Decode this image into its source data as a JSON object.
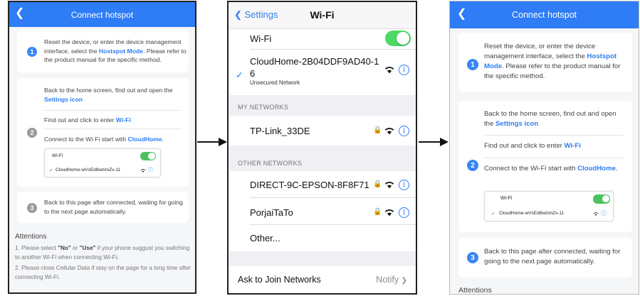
{
  "left_screen": {
    "title": "Connect hotspot",
    "step1": {
      "num": "1",
      "pre": "Reset the device, or enter the device management interface, select the ",
      "hl": "Hostspot Mode",
      "post": ". Please refer to the product manual for the specific method."
    },
    "step2": {
      "num": "2",
      "line1_pre": "Back to the home screen, find out and open the ",
      "line1_hl": "Settings icon",
      "line2_pre": "Find out and click to enter ",
      "line2_hl": "Wi-Fi",
      "line3_pre": "Connect to the Wi-Fi start with ",
      "line3_hl": "CloudHome",
      "line3_post": "."
    },
    "mini_wifi": {
      "label": "Wi-Fi",
      "network": "CloudHome-wVsEd8wzimZv-11"
    },
    "step3": {
      "num": "3",
      "text": "Back to this page after connected, waiting for going to the next page automatically."
    },
    "attentions": {
      "title": "Attentions",
      "item1_pre": "1. Please select ",
      "item1_no": "\"No\"",
      "item1_mid": " or ",
      "item1_use": "\"Use\"",
      "item1_post": " if your phone suggust you switching to another Wi-Fi when connecting Wi-Fi;",
      "item2": "2. Please close Cellular Data if stay on the page for a long time after connecting Wi-Fi."
    }
  },
  "middle_screen": {
    "back_label": "Settings",
    "title": "Wi-Fi",
    "wifi_label": "Wi-Fi",
    "current_network": {
      "line1": "CloudHome-2B04DDF9AD40-1",
      "line2": "6",
      "status": "Unsecured Network"
    },
    "my_networks_header": "MY NETWORKS",
    "my_networks": [
      {
        "name": "TP-Link_33DE"
      }
    ],
    "other_networks_header": "OTHER NETWORKS",
    "other_networks": [
      {
        "name": "DIRECT-9C-EPSON-8F8F71"
      },
      {
        "name": "PorjaiTaTo"
      }
    ],
    "other_label": "Other...",
    "ask_label": "Ask to Join Networks",
    "ask_value": "Notify"
  },
  "right_screen": {
    "title": "Connect hotspot",
    "step1": {
      "num": "1",
      "pre": "Reset the device, or enter the device management interface, select the ",
      "hl": "Hostspot Mode",
      "post": ". Please refer to the product manual for the specific method."
    },
    "step2": {
      "num": "2",
      "line1_pre": "Back to the home screen, find out and open the ",
      "line1_hl": "Settings icon",
      "line2_pre": "Find out and click to enter ",
      "line2_hl": "Wi-Fi",
      "line3_pre": "Connect to the Wi-Fi start with ",
      "line3_hl": "CloudHome",
      "line3_post": "."
    },
    "mini_wifi": {
      "label": "Wi-Fi",
      "network": "CloudHome-wVsEd8wzimZv-11"
    },
    "step3": {
      "num": "3",
      "text": "Back to this page after connected, waiting for going to the next page automatically."
    },
    "attentions_title": "Attentions"
  },
  "icons": {
    "back": "chevron-left-icon",
    "check": "checkmark-icon",
    "wifi": "wifi-icon",
    "lock": "lock-icon",
    "info": "info-icon",
    "arrow": "arrow-right-icon"
  },
  "colors": {
    "accent": "#2e7cf6",
    "toggle_on": "#4cd964",
    "ios_blue": "#2f7df6"
  }
}
